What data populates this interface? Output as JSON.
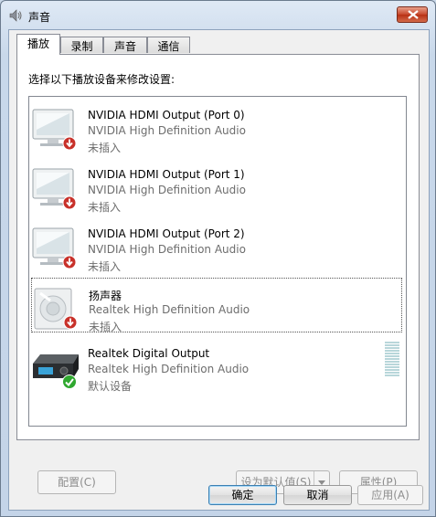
{
  "window": {
    "title": "声音"
  },
  "tabs": [
    {
      "label": "播放",
      "active": true
    },
    {
      "label": "录制",
      "active": false
    },
    {
      "label": "声音",
      "active": false
    },
    {
      "label": "通信",
      "active": false
    }
  ],
  "playback": {
    "instruction": "选择以下播放设备来修改设置:",
    "devices": [
      {
        "name": "NVIDIA HDMI Output (Port 0)",
        "description": "NVIDIA High Definition Audio",
        "status": "未插入",
        "icon": "monitor-icon",
        "badge": "unplugged-badge-icon"
      },
      {
        "name": "NVIDIA HDMI Output (Port 1)",
        "description": "NVIDIA High Definition Audio",
        "status": "未插入",
        "icon": "monitor-icon",
        "badge": "unplugged-badge-icon"
      },
      {
        "name": "NVIDIA HDMI Output (Port 2)",
        "description": "NVIDIA High Definition Audio",
        "status": "未插入",
        "icon": "monitor-icon",
        "badge": "unplugged-badge-icon"
      },
      {
        "name": "扬声器",
        "description": "Realtek High Definition Audio",
        "status": "未插入",
        "icon": "speaker-icon",
        "badge": "unplugged-badge-icon"
      },
      {
        "name": "Realtek Digital Output",
        "description": "Realtek High Definition Audio",
        "status": "默认设备",
        "icon": "digital-output-device-icon",
        "badge": "default-check-icon"
      }
    ],
    "buttons": {
      "configure": "配置(C)",
      "set_default": "设为默认值(S)",
      "properties": "属性(P)"
    }
  },
  "dialog_buttons": {
    "ok": "确定",
    "cancel": "取消",
    "apply": "应用(A)"
  },
  "colors": {
    "unplugged_badge": "#c8312a",
    "default_check": "#2fa82f",
    "level_meter": "#b8d6da"
  }
}
